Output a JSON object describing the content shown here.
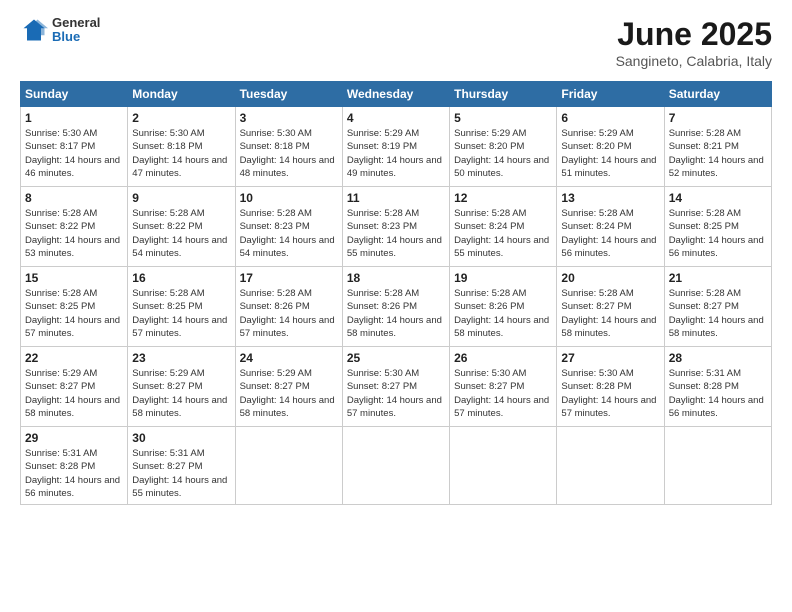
{
  "header": {
    "logo_general": "General",
    "logo_blue": "Blue",
    "month": "June 2025",
    "location": "Sangineto, Calabria, Italy"
  },
  "weekdays": [
    "Sunday",
    "Monday",
    "Tuesday",
    "Wednesday",
    "Thursday",
    "Friday",
    "Saturday"
  ],
  "weeks": [
    [
      {
        "day": "1",
        "sunrise": "Sunrise: 5:30 AM",
        "sunset": "Sunset: 8:17 PM",
        "daylight": "Daylight: 14 hours and 46 minutes."
      },
      {
        "day": "2",
        "sunrise": "Sunrise: 5:30 AM",
        "sunset": "Sunset: 8:18 PM",
        "daylight": "Daylight: 14 hours and 47 minutes."
      },
      {
        "day": "3",
        "sunrise": "Sunrise: 5:30 AM",
        "sunset": "Sunset: 8:18 PM",
        "daylight": "Daylight: 14 hours and 48 minutes."
      },
      {
        "day": "4",
        "sunrise": "Sunrise: 5:29 AM",
        "sunset": "Sunset: 8:19 PM",
        "daylight": "Daylight: 14 hours and 49 minutes."
      },
      {
        "day": "5",
        "sunrise": "Sunrise: 5:29 AM",
        "sunset": "Sunset: 8:20 PM",
        "daylight": "Daylight: 14 hours and 50 minutes."
      },
      {
        "day": "6",
        "sunrise": "Sunrise: 5:29 AM",
        "sunset": "Sunset: 8:20 PM",
        "daylight": "Daylight: 14 hours and 51 minutes."
      },
      {
        "day": "7",
        "sunrise": "Sunrise: 5:28 AM",
        "sunset": "Sunset: 8:21 PM",
        "daylight": "Daylight: 14 hours and 52 minutes."
      }
    ],
    [
      {
        "day": "8",
        "sunrise": "Sunrise: 5:28 AM",
        "sunset": "Sunset: 8:22 PM",
        "daylight": "Daylight: 14 hours and 53 minutes."
      },
      {
        "day": "9",
        "sunrise": "Sunrise: 5:28 AM",
        "sunset": "Sunset: 8:22 PM",
        "daylight": "Daylight: 14 hours and 54 minutes."
      },
      {
        "day": "10",
        "sunrise": "Sunrise: 5:28 AM",
        "sunset": "Sunset: 8:23 PM",
        "daylight": "Daylight: 14 hours and 54 minutes."
      },
      {
        "day": "11",
        "sunrise": "Sunrise: 5:28 AM",
        "sunset": "Sunset: 8:23 PM",
        "daylight": "Daylight: 14 hours and 55 minutes."
      },
      {
        "day": "12",
        "sunrise": "Sunrise: 5:28 AM",
        "sunset": "Sunset: 8:24 PM",
        "daylight": "Daylight: 14 hours and 55 minutes."
      },
      {
        "day": "13",
        "sunrise": "Sunrise: 5:28 AM",
        "sunset": "Sunset: 8:24 PM",
        "daylight": "Daylight: 14 hours and 56 minutes."
      },
      {
        "day": "14",
        "sunrise": "Sunrise: 5:28 AM",
        "sunset": "Sunset: 8:25 PM",
        "daylight": "Daylight: 14 hours and 56 minutes."
      }
    ],
    [
      {
        "day": "15",
        "sunrise": "Sunrise: 5:28 AM",
        "sunset": "Sunset: 8:25 PM",
        "daylight": "Daylight: 14 hours and 57 minutes."
      },
      {
        "day": "16",
        "sunrise": "Sunrise: 5:28 AM",
        "sunset": "Sunset: 8:25 PM",
        "daylight": "Daylight: 14 hours and 57 minutes."
      },
      {
        "day": "17",
        "sunrise": "Sunrise: 5:28 AM",
        "sunset": "Sunset: 8:26 PM",
        "daylight": "Daylight: 14 hours and 57 minutes."
      },
      {
        "day": "18",
        "sunrise": "Sunrise: 5:28 AM",
        "sunset": "Sunset: 8:26 PM",
        "daylight": "Daylight: 14 hours and 58 minutes."
      },
      {
        "day": "19",
        "sunrise": "Sunrise: 5:28 AM",
        "sunset": "Sunset: 8:26 PM",
        "daylight": "Daylight: 14 hours and 58 minutes."
      },
      {
        "day": "20",
        "sunrise": "Sunrise: 5:28 AM",
        "sunset": "Sunset: 8:27 PM",
        "daylight": "Daylight: 14 hours and 58 minutes."
      },
      {
        "day": "21",
        "sunrise": "Sunrise: 5:28 AM",
        "sunset": "Sunset: 8:27 PM",
        "daylight": "Daylight: 14 hours and 58 minutes."
      }
    ],
    [
      {
        "day": "22",
        "sunrise": "Sunrise: 5:29 AM",
        "sunset": "Sunset: 8:27 PM",
        "daylight": "Daylight: 14 hours and 58 minutes."
      },
      {
        "day": "23",
        "sunrise": "Sunrise: 5:29 AM",
        "sunset": "Sunset: 8:27 PM",
        "daylight": "Daylight: 14 hours and 58 minutes."
      },
      {
        "day": "24",
        "sunrise": "Sunrise: 5:29 AM",
        "sunset": "Sunset: 8:27 PM",
        "daylight": "Daylight: 14 hours and 58 minutes."
      },
      {
        "day": "25",
        "sunrise": "Sunrise: 5:30 AM",
        "sunset": "Sunset: 8:27 PM",
        "daylight": "Daylight: 14 hours and 57 minutes."
      },
      {
        "day": "26",
        "sunrise": "Sunrise: 5:30 AM",
        "sunset": "Sunset: 8:27 PM",
        "daylight": "Daylight: 14 hours and 57 minutes."
      },
      {
        "day": "27",
        "sunrise": "Sunrise: 5:30 AM",
        "sunset": "Sunset: 8:28 PM",
        "daylight": "Daylight: 14 hours and 57 minutes."
      },
      {
        "day": "28",
        "sunrise": "Sunrise: 5:31 AM",
        "sunset": "Sunset: 8:28 PM",
        "daylight": "Daylight: 14 hours and 56 minutes."
      }
    ],
    [
      {
        "day": "29",
        "sunrise": "Sunrise: 5:31 AM",
        "sunset": "Sunset: 8:28 PM",
        "daylight": "Daylight: 14 hours and 56 minutes."
      },
      {
        "day": "30",
        "sunrise": "Sunrise: 5:31 AM",
        "sunset": "Sunset: 8:27 PM",
        "daylight": "Daylight: 14 hours and 55 minutes."
      },
      null,
      null,
      null,
      null,
      null
    ]
  ]
}
